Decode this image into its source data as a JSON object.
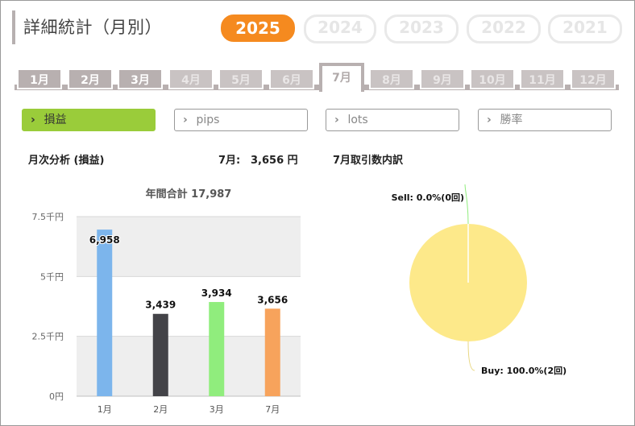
{
  "page": {
    "title": "詳細統計（月別）"
  },
  "years": {
    "items": [
      "2025",
      "2024",
      "2023",
      "2022",
      "2021"
    ],
    "selected": "2025"
  },
  "months": {
    "items": [
      "1月",
      "2月",
      "3月",
      "4月",
      "5月",
      "6月",
      "7月",
      "8月",
      "9月",
      "10月",
      "11月",
      "12月"
    ],
    "with_data": [
      "1月",
      "2月",
      "3月",
      "7月"
    ],
    "selected": "7月"
  },
  "metrics": {
    "items": [
      "損益",
      "pips",
      "lots",
      "勝率"
    ],
    "selected": "損益"
  },
  "summary": {
    "monthly_label": "月次分析 (損益)",
    "month_value_label": "7月:",
    "month_value": "3,656 円",
    "breakdown_label": "7月取引数内訳"
  },
  "colors": {
    "accent": "#f58a1f",
    "metric_active": "#9acc3a",
    "tab": "#b8b0b0"
  },
  "chart_data": [
    {
      "type": "bar",
      "title": "年間合計 17,987",
      "categories": [
        "1月",
        "2月",
        "3月",
        "7月"
      ],
      "values": [
        6958,
        3439,
        3934,
        3656
      ],
      "value_labels": [
        "6,958",
        "3,439",
        "3,934",
        "3,656"
      ],
      "colors": [
        "#7cb5ec",
        "#434348",
        "#90ed7d",
        "#f7a35c"
      ],
      "ylim": [
        0,
        7500
      ],
      "ytick_values": [
        0,
        2500,
        5000,
        7500
      ],
      "yticks": [
        "0円",
        "2.5千円",
        "5千円",
        "7.5千円"
      ],
      "grid": true
    },
    {
      "type": "pie",
      "categories": [
        "Sell",
        "Buy"
      ],
      "values": [
        0.0,
        100.0
      ],
      "labels": [
        "Sell: 0.0%(0回)",
        "Buy: 100.0%(2回)"
      ],
      "colors": [
        "#90ed7d",
        "#fde98a"
      ]
    }
  ]
}
